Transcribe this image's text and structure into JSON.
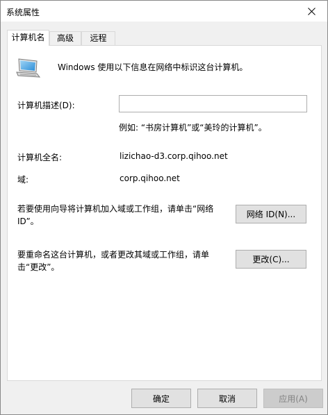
{
  "window": {
    "title": "系统属性"
  },
  "tabs": [
    {
      "label": "计算机名",
      "active": true
    },
    {
      "label": "高级",
      "active": false
    },
    {
      "label": "远程",
      "active": false
    }
  ],
  "computer_name_tab": {
    "intro": "Windows 使用以下信息在网络中标识这台计算机。",
    "description_label": "计算机描述(D):",
    "description_value": "",
    "description_placeholder": "",
    "example": "例如: “书房计算机”或“美玲的计算机”。",
    "full_name_label": "计算机全名:",
    "full_name_value": "lizichao-d3.corp.qihoo.net",
    "domain_label": "域:",
    "domain_value": "corp.qihoo.net",
    "network_text": "若要使用向导将计算机加入域或工作组，请单击“网络 ID”。",
    "network_button": "网络 ID(N)...",
    "change_text": "要重命名这台计算机，或者更改其域或工作组，请单击“更改”。",
    "change_button": "更改(C)..."
  },
  "footer": {
    "ok_label": "确定",
    "cancel_label": "取消",
    "apply_label": "应用(A)"
  },
  "icons": {
    "close": "close-icon",
    "computer": "computer-icon"
  },
  "colors": {
    "focus_border": "#0078d7",
    "button_bg": "#e1e1e1",
    "panel_bg": "#ffffff",
    "window_bg": "#f0f0f0"
  }
}
